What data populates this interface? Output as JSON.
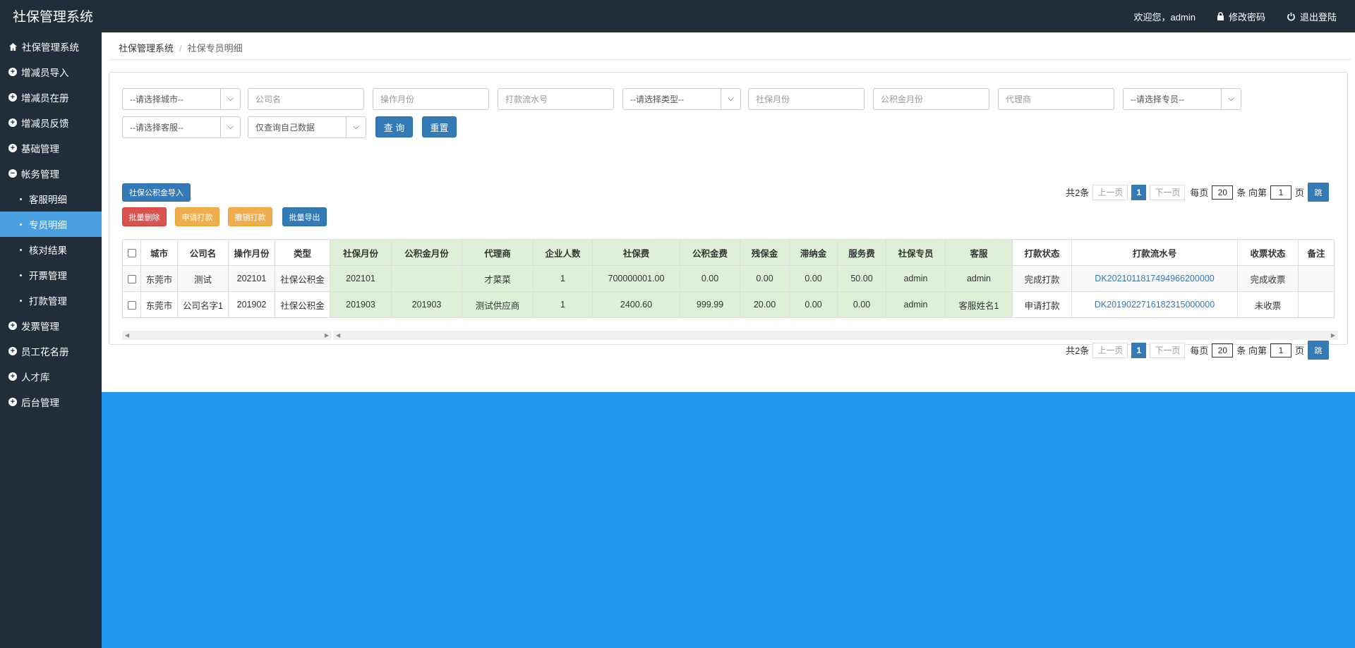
{
  "app": {
    "title": "社保管理系统"
  },
  "topbar": {
    "welcome": "欢迎您，admin",
    "change_pwd": "修改密码",
    "logout": "退出登陆"
  },
  "sidebar": {
    "items": [
      {
        "label": "社保管理系统",
        "icon": "home-icon"
      },
      {
        "label": "增减员导入",
        "icon": "plus-circle-icon"
      },
      {
        "label": "增减员在册",
        "icon": "plus-circle-icon"
      },
      {
        "label": "增减员反馈",
        "icon": "plus-circle-icon"
      },
      {
        "label": "基础管理",
        "icon": "plus-circle-icon"
      },
      {
        "label": "帐务管理",
        "icon": "minus-circle-icon"
      },
      {
        "label": "客服明细",
        "icon": "dot"
      },
      {
        "label": "专员明细",
        "icon": "dot",
        "active": true
      },
      {
        "label": "核对结果",
        "icon": "dot"
      },
      {
        "label": "开票管理",
        "icon": "dot"
      },
      {
        "label": "打款管理",
        "icon": "dot"
      },
      {
        "label": "发票管理",
        "icon": "plus-circle-icon"
      },
      {
        "label": "员工花名册",
        "icon": "plus-circle-icon"
      },
      {
        "label": "人才库",
        "icon": "plus-circle-icon"
      },
      {
        "label": "后台管理",
        "icon": "plus-circle-icon"
      }
    ]
  },
  "breadcrumb": {
    "root": "社保管理系统",
    "sep": "/",
    "current": "社保专员明细"
  },
  "filters": {
    "city": "--请选择城市--",
    "company_ph": "公司名",
    "op_month_ph": "操作月份",
    "serial_ph": "打款流水号",
    "type": "--请选择类型--",
    "ss_month_ph": "社保月份",
    "hf_month_ph": "公积金月份",
    "agent_ph": "代理商",
    "specialist": "--请选择专员--",
    "service": "--请选择客服--",
    "own_data": "仅查询自己数据",
    "query": "查 询",
    "reset": "重置"
  },
  "actions": {
    "import": "社保公积金导入",
    "batch_delete": "批量删除",
    "apply_pay": "申请打款",
    "revoke_pay": "撤销打款",
    "batch_export": "批量导出"
  },
  "pager": {
    "total": "共2条",
    "prev": "上一页",
    "page": "1",
    "next": "下一页",
    "per_page": "每页",
    "size": "20",
    "unit": "条 向第",
    "goto": "1",
    "page_unit": "页",
    "go": "跳"
  },
  "table": {
    "headers": [
      "城市",
      "公司名",
      "操作月份",
      "类型",
      "社保月份",
      "公积金月份",
      "代理商",
      "企业人数",
      "社保费",
      "公积金费",
      "残保金",
      "滞纳金",
      "服务费",
      "社保专员",
      "客服",
      "打款状态",
      "打款流水号",
      "收票状态",
      "备注"
    ],
    "rows": [
      [
        "东莞市",
        "测试",
        "202101",
        "社保公积金",
        "202101",
        "",
        "才菜菜",
        "1",
        "700000001.00",
        "0.00",
        "0.00",
        "0.00",
        "50.00",
        "admin",
        "admin",
        "完成打款",
        "DK2021011817494966200000",
        "完成收票",
        ""
      ],
      [
        "东莞市",
        "公司名字1",
        "201902",
        "社保公积金",
        "201903",
        "201903",
        "测试供应商",
        "1",
        "2400.60",
        "999.99",
        "20.00",
        "0.00",
        "0.00",
        "admin",
        "客服姓名1",
        "申请打款",
        "DK2019022716182315000000",
        "未收票",
        ""
      ]
    ]
  },
  "colors": {
    "topbar": "#222d3a",
    "sidebar_active": "#4a9fe0",
    "primary": "#337ab7",
    "danger": "#d9534f",
    "warning": "#f0ad4e",
    "header_green": "#dff0d8",
    "bottom_blue": "#2196ec"
  }
}
